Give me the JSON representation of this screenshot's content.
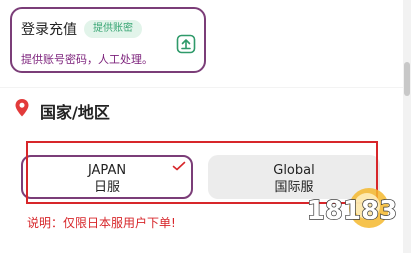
{
  "login": {
    "title": "登录充值",
    "badge": "提供账密",
    "description": "提供账号密码，人工处理。"
  },
  "section": {
    "title": "国家/地区"
  },
  "regions": [
    {
      "code": "JAPAN",
      "name": "日服",
      "selected": true
    },
    {
      "code": "Global",
      "name": "国际服",
      "selected": false
    }
  ],
  "note": "说明：仅限日本服用户下单!",
  "watermark": "18183",
  "colors": {
    "accent": "#7b3d78",
    "badge_text": "#3aa675",
    "badge_bg": "#e2f4ea",
    "highlight": "#d7262a",
    "unselected_bg": "#ececec"
  }
}
